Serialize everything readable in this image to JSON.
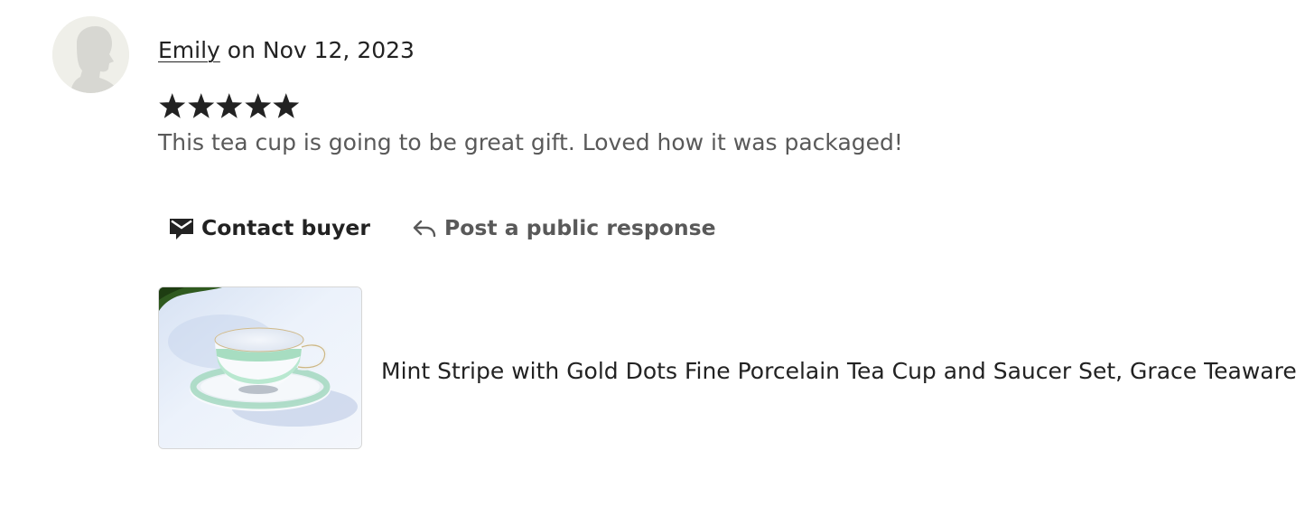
{
  "review": {
    "reviewer_name": "Emily",
    "date_text": " on Nov 12, 2023",
    "rating": 5,
    "rating_max": 5,
    "text": "This tea cup is going to be great gift. Loved how it was packaged!"
  },
  "actions": {
    "contact_label": "Contact buyer",
    "contact_icon": "envelope-icon",
    "respond_label": "Post a public response",
    "respond_icon": "reply-arrow-icon"
  },
  "listing": {
    "title": "Mint Stripe with Gold Dots Fine Porcelain Tea Cup and Saucer Set, Grace Teaware"
  },
  "colors": {
    "text_primary": "#222222",
    "text_secondary": "#595959",
    "avatar_bg": "#efefe9",
    "avatar_silhouette": "#d7d7d2",
    "star": "#222222"
  }
}
